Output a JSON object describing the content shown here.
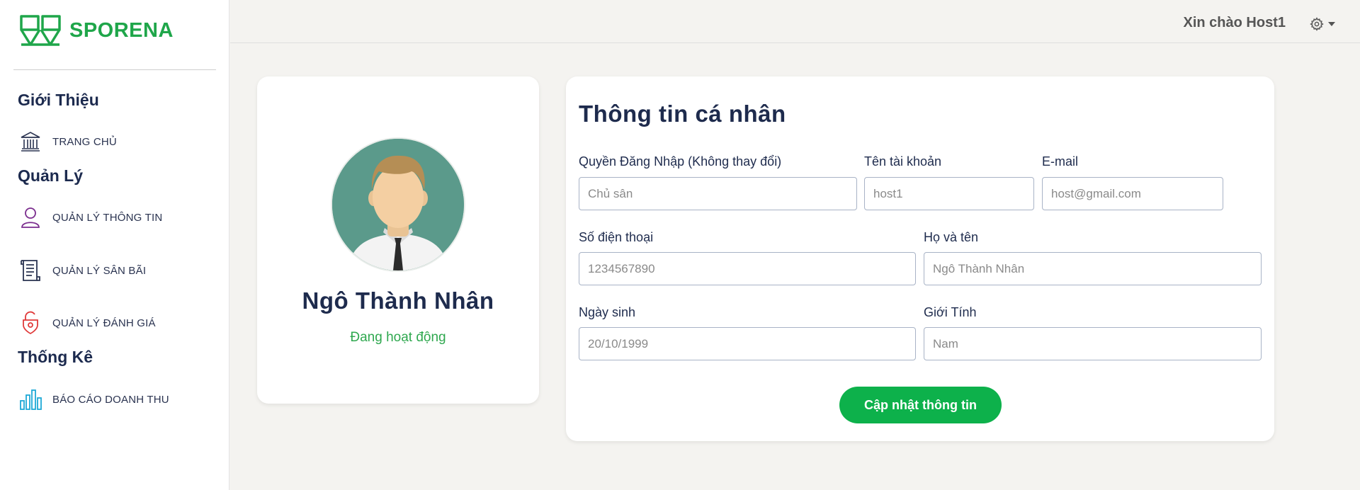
{
  "brand": {
    "name": "SPORENA",
    "color": "#1fa64a"
  },
  "sidebar": {
    "sections": [
      {
        "title": "Giới Thiệu"
      },
      {
        "title": "Quản Lý"
      },
      {
        "title": "Thống Kê"
      }
    ],
    "items": [
      {
        "label": "TRANG CHỦ",
        "icon": "bank-icon"
      },
      {
        "label": "QUẢN LÝ THÔNG TIN",
        "icon": "user-icon"
      },
      {
        "label": "QUẢN LÝ SÂN BÃI",
        "icon": "document-icon"
      },
      {
        "label": "QUẢN LÝ ĐÁNH GIÁ",
        "icon": "unlock-pin-icon"
      },
      {
        "label": "BÁO CÁO DOANH THU",
        "icon": "bar-chart-icon"
      }
    ]
  },
  "header": {
    "greeting": "Xin chào Host1",
    "settings_icon": "gear-icon"
  },
  "profile": {
    "name": "Ngô Thành Nhân",
    "status": "Đang hoạt động",
    "status_color": "#2fa84f",
    "avatar_icon": "man-avatar-icon"
  },
  "form": {
    "title": "Thông tin cá nhân",
    "fields": {
      "role": {
        "label": "Quyền Đăng Nhập (Không thay đổi)",
        "placeholder": "Chủ sân"
      },
      "username": {
        "label": "Tên tài khoản",
        "placeholder": "host1"
      },
      "email": {
        "label": "E-mail",
        "placeholder": "host@gmail.com"
      },
      "phone": {
        "label": "Số điện thoại",
        "placeholder": "1234567890"
      },
      "fullname": {
        "label": "Họ và tên",
        "placeholder": "Ngô Thành Nhân"
      },
      "birthday": {
        "label": "Ngày sinh",
        "placeholder": "20/10/1999"
      },
      "gender": {
        "label": "Giới Tính",
        "placeholder": "Nam"
      }
    },
    "submit_label": "Cập nhật thông tin",
    "submit_color": "#0db14b"
  }
}
